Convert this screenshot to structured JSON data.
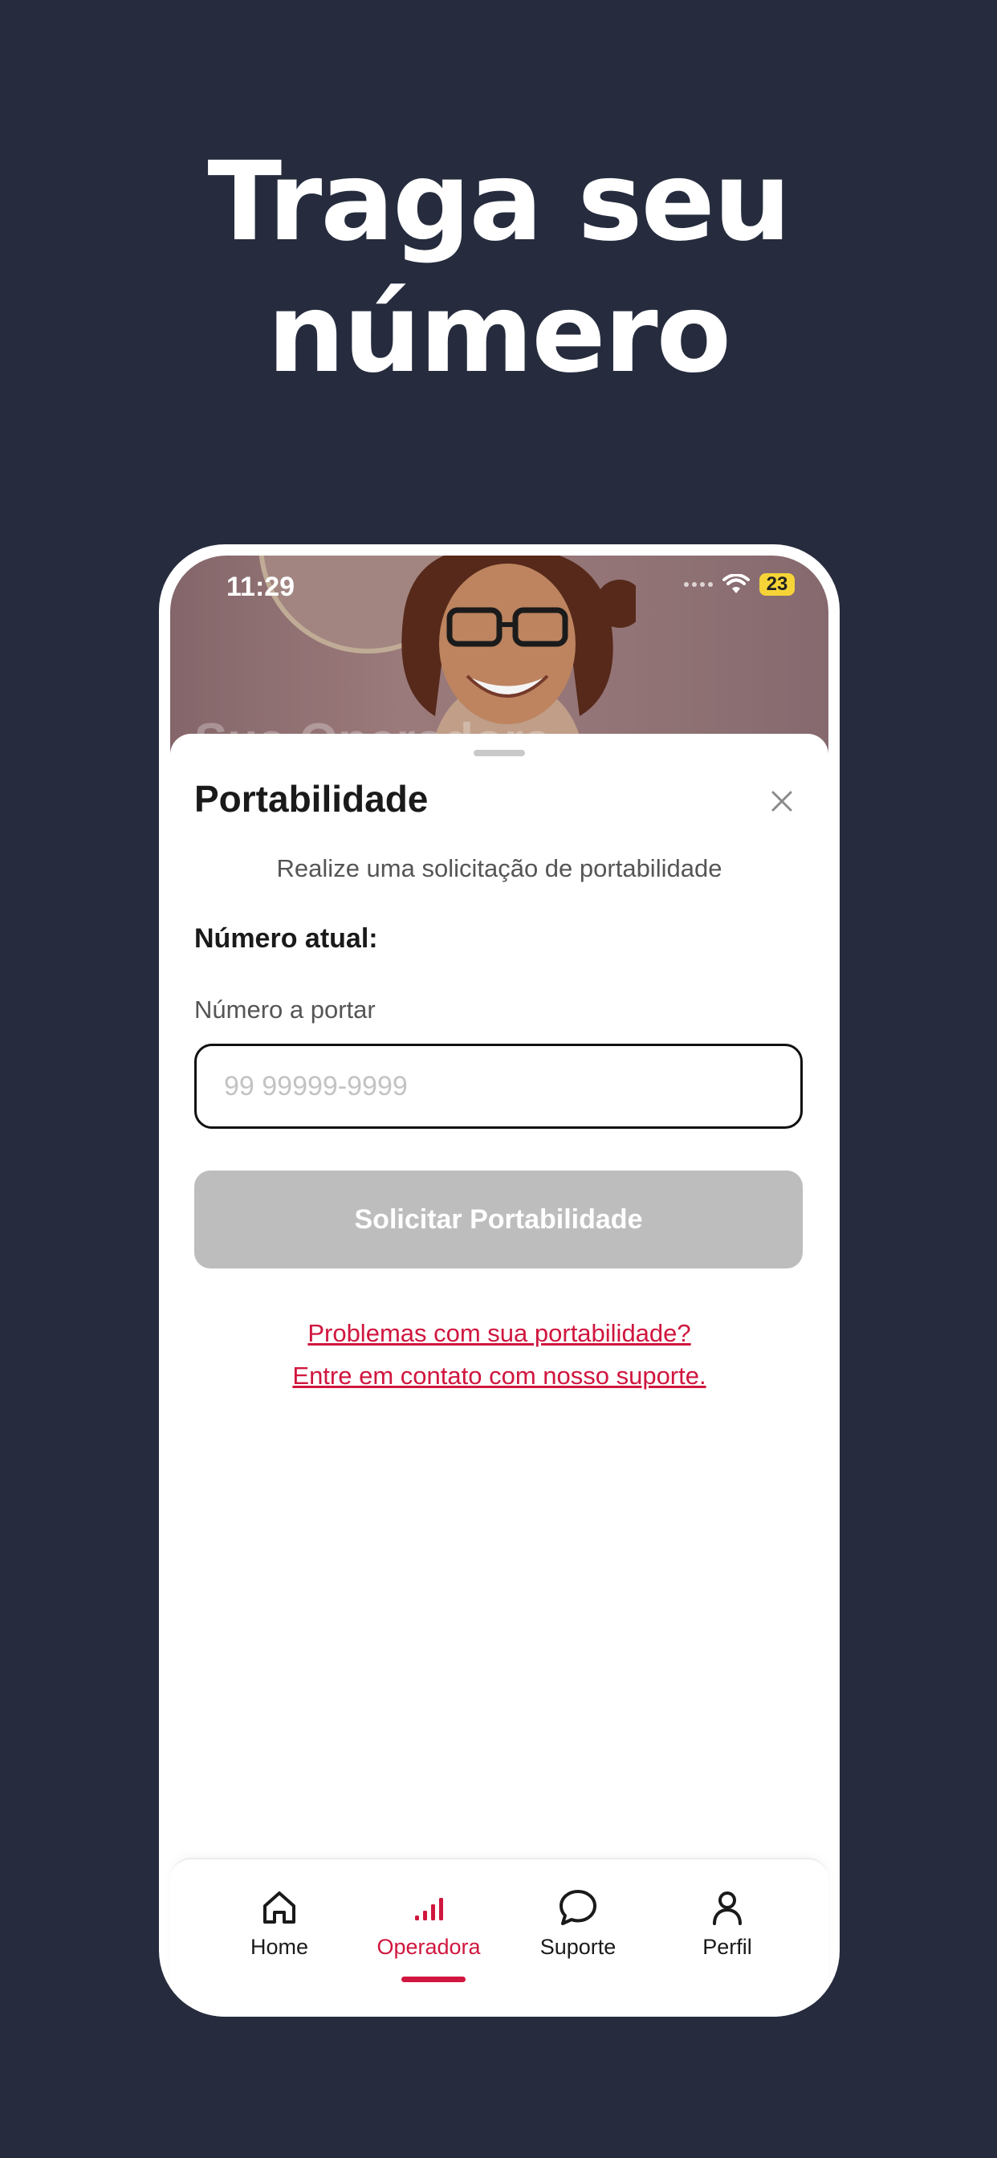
{
  "headline": {
    "line1": "Traga seu",
    "line2": "número"
  },
  "status_bar": {
    "time": "11:29",
    "battery": "23"
  },
  "hero": {
    "title": "Sua Operadora"
  },
  "sheet": {
    "title": "Portabilidade",
    "subtitle": "Realize uma solicitação de portabilidade",
    "current_number_label": "Número atual:",
    "field_label": "Número a portar",
    "field_placeholder": "99 99999-9999",
    "field_value": "",
    "submit_label": "Solicitar Portabilidade",
    "support_line1": "Problemas com sua portabilidade?",
    "support_line2": "Entre em contato com nosso suporte."
  },
  "tabbar": {
    "items": [
      {
        "label": "Home",
        "icon": "home-icon"
      },
      {
        "label": "Operadora",
        "icon": "signal-icon",
        "active": true
      },
      {
        "label": "Suporte",
        "icon": "chat-icon"
      },
      {
        "label": "Perfil",
        "icon": "user-icon"
      }
    ]
  },
  "colors": {
    "background": "#262c3e",
    "accent": "#d0163e",
    "button_disabled": "#bdbdbd",
    "battery": "#f6d437"
  }
}
